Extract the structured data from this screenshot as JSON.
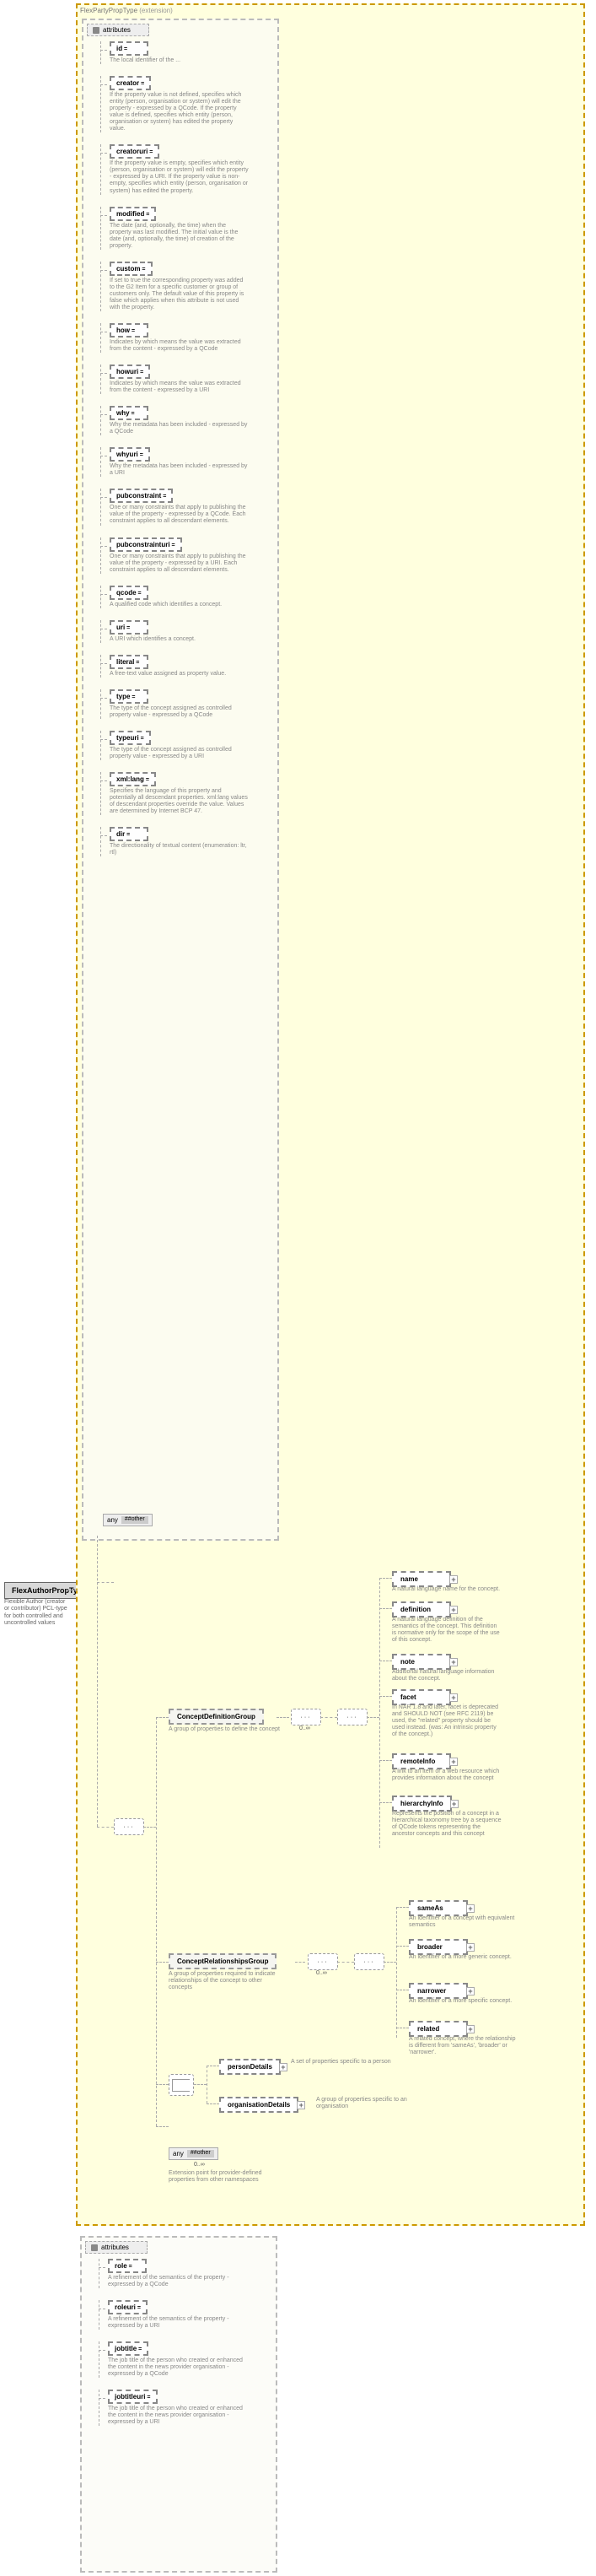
{
  "mainType": {
    "name": "FlexAuthorPropType",
    "desc": "Flexible Author (creator or contributor) PCL-type for both controlled and uncontrolled values"
  },
  "extension": {
    "label": "FlexPartyPropType",
    "suffix": "(extension)"
  },
  "attrHeader": "attributes",
  "attrs": [
    {
      "name": "id",
      "desc": "The local identifier of the ..."
    },
    {
      "name": "creator",
      "desc": "If the property value is not defined, specifies which entity (person, organisation or system) will edit the property - expressed by a QCode. If the property value is defined, specifies which entity (person, organisation or system) has edited the property value."
    },
    {
      "name": "creatoruri",
      "desc": "If the property value is empty, specifies which entity (person, organisation or system) will edit the property - expressed by a URI. If the property value is non-empty, specifies which entity (person, organisation or system) has edited the property."
    },
    {
      "name": "modified",
      "desc": "The date (and, optionally, the time) when the property was last modified. The initial value is the date (and, optionally, the time) of creation of the property."
    },
    {
      "name": "custom",
      "desc": "If set to true the corresponding property was added to the G2 Item for a specific customer or group of customers only. The default value of this property is false which applies when this attribute is not used with the property."
    },
    {
      "name": "how",
      "desc": "Indicates by which means the value was extracted from the content - expressed by a QCode"
    },
    {
      "name": "howuri",
      "desc": "Indicates by which means the value was extracted from the content - expressed by a URI"
    },
    {
      "name": "why",
      "desc": "Why the metadata has been included - expressed by a QCode"
    },
    {
      "name": "whyuri",
      "desc": "Why the metadata has been included - expressed by a URI"
    },
    {
      "name": "pubconstraint",
      "desc": "One or many constraints that apply to publishing the value of the property - expressed by a QCode. Each constraint applies to all descendant elements."
    },
    {
      "name": "pubconstrainturi",
      "desc": "One or many constraints that apply to publishing the value of the property - expressed by a URI. Each constraint applies to all descendant elements."
    },
    {
      "name": "qcode",
      "desc": "A qualified code which identifies a concept."
    },
    {
      "name": "uri",
      "desc": "A URI which identifies a concept."
    },
    {
      "name": "literal",
      "desc": "A free-text value assigned as property value."
    },
    {
      "name": "type",
      "desc": "The type of the concept assigned as controlled property value - expressed by a QCode"
    },
    {
      "name": "typeuri",
      "desc": "The type of the concept assigned as controlled property value - expressed by a URI"
    },
    {
      "name": "xml:lang",
      "desc": "Specifies the language of this property and potentially all descendant properties. xml:lang values of descendant properties override the value. Values are determined by Internet BCP 47."
    },
    {
      "name": "dir",
      "desc": "The directionality of textual content (enumeration: ltr, rtl)"
    }
  ],
  "anyLabel": "any",
  "anyOther": "##other",
  "groups": {
    "cdg": {
      "name": "ConceptDefinitionGroup",
      "desc": "A group of properties to define the concept",
      "card": "0..∞"
    },
    "crg": {
      "name": "ConceptRelationshipsGroup",
      "desc": "A group of properties required to indicate relationships of the concept to other concepts",
      "card": "0..∞"
    }
  },
  "cdgElements": [
    {
      "name": "name",
      "desc": "A natural language name for the concept."
    },
    {
      "name": "definition",
      "desc": "A natural language definition of the semantics of the concept. This definition is normative only for the scope of the use of this concept."
    },
    {
      "name": "note",
      "desc": "Additional natural language information about the concept."
    },
    {
      "name": "facet",
      "desc": "In NAR 1.8 and later, facet is deprecated and SHOULD NOT (see RFC 2119) be used, the \"related\" property should be used instead. (was: An intrinsic property of the concept.)"
    },
    {
      "name": "remoteInfo",
      "desc": "A link to an item or a web resource which provides information about the concept"
    },
    {
      "name": "hierarchyInfo",
      "desc": "Represents the position of a concept in a hierarchical taxonomy tree by a sequence of QCode tokens representing the ancestor concepts and this concept"
    }
  ],
  "crgElements": [
    {
      "name": "sameAs",
      "desc": "An identifier of a concept with equivalent semantics"
    },
    {
      "name": "broader",
      "desc": "An identifier of a more generic concept."
    },
    {
      "name": "narrower",
      "desc": "An identifier of a more specific concept."
    },
    {
      "name": "related",
      "desc": "A related concept, where the relationship is different from 'sameAs', 'broader' or 'narrower'."
    }
  ],
  "details": {
    "person": {
      "name": "personDetails",
      "desc": "A set of properties specific to a person"
    },
    "org": {
      "name": "organisationDetails",
      "desc": "A group of properties specific to an organisation"
    }
  },
  "extAny": {
    "card": "0..∞",
    "desc": "Extension point for provider-defined properties from other namespaces"
  },
  "attrs2Header": "attributes",
  "attrs2": [
    {
      "name": "role",
      "desc": "A refinement of the semantics of the property - expressed by a QCode"
    },
    {
      "name": "roleuri",
      "desc": "A refinement of the semantics of the property - expressed by a URI"
    },
    {
      "name": "jobtitle",
      "desc": "The job title of the person who created or enhanced the content in the news provider organisation - expressed by a QCode"
    },
    {
      "name": "jobtitleuri",
      "desc": "The job title of the person who created or enhanced the content in the news provider organisation - expressed by a URI"
    }
  ],
  "chart_data": null
}
